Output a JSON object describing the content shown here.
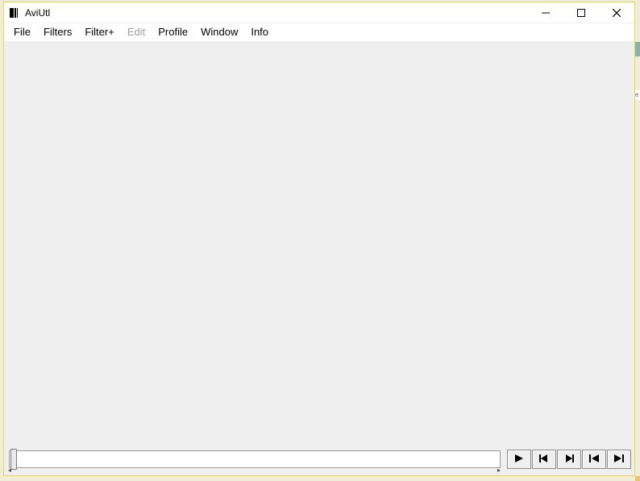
{
  "titlebar": {
    "title": "AviUtl"
  },
  "menu": {
    "items": [
      {
        "label": "File",
        "disabled": false
      },
      {
        "label": "Filters",
        "disabled": false
      },
      {
        "label": "Filter+",
        "disabled": false
      },
      {
        "label": "Edit",
        "disabled": true
      },
      {
        "label": "Profile",
        "disabled": false
      },
      {
        "label": "Window",
        "disabled": false
      },
      {
        "label": "Info",
        "disabled": false
      }
    ]
  },
  "playback": {
    "slider_position": 0,
    "buttons": {
      "play": "play-icon",
      "step_back": "step-back-icon",
      "step_forward": "step-forward-icon",
      "go_start": "go-start-icon",
      "go_end": "go-end-icon"
    }
  }
}
